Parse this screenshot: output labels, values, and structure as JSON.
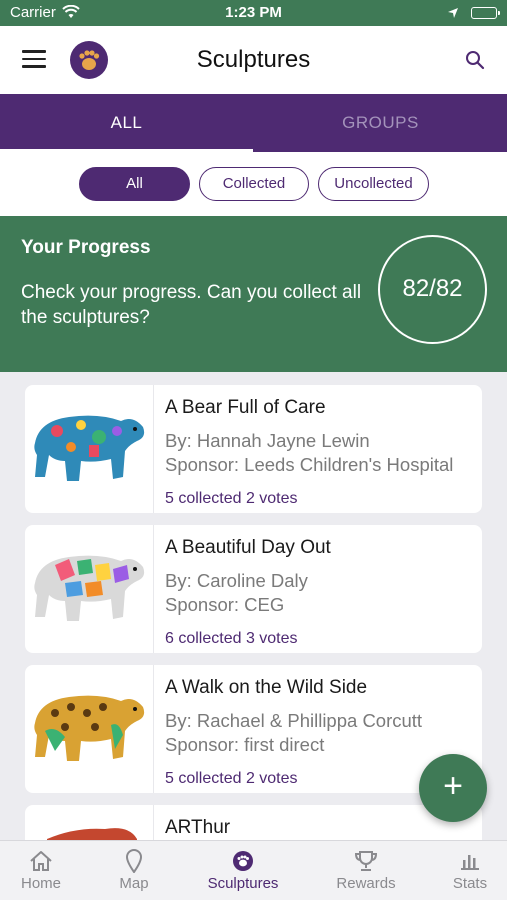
{
  "status_bar": {
    "carrier": "Carrier",
    "time": "1:23 PM"
  },
  "header": {
    "title": "Sculptures"
  },
  "tabs": [
    {
      "label": "ALL",
      "active": true
    },
    {
      "label": "GROUPS",
      "active": false
    }
  ],
  "filters": [
    {
      "label": "All",
      "selected": true
    },
    {
      "label": "Collected",
      "selected": false
    },
    {
      "label": "Uncollected",
      "selected": false
    }
  ],
  "progress": {
    "title": "Your Progress",
    "text": "Check your progress. Can you collect all the sculptures?",
    "value": "82/82"
  },
  "sculptures": [
    {
      "title": "A Bear Full of Care",
      "artist": "By: Hannah Jayne Lewin",
      "sponsor": "Sponsor: Leeds Children's Hospital",
      "stats": "5 collected 2 votes"
    },
    {
      "title": "A Beautiful Day Out",
      "artist": "By: Caroline Daly",
      "sponsor": "Sponsor: CEG",
      "stats": "6 collected 3 votes"
    },
    {
      "title": "A Walk on the Wild Side",
      "artist": "By: Rachael & Phillippa Corcutt",
      "sponsor": "Sponsor: first direct",
      "stats": "5 collected 2 votes"
    },
    {
      "title": "ARThur",
      "artist": "",
      "sponsor": "",
      "stats": ""
    }
  ],
  "fab": {
    "label": "+"
  },
  "nav": [
    {
      "label": "Home",
      "icon": "home-icon"
    },
    {
      "label": "Map",
      "icon": "map-pin-icon"
    },
    {
      "label": "Sculptures",
      "icon": "bear-logo-icon",
      "active": true
    },
    {
      "label": "Rewards",
      "icon": "trophy-icon"
    },
    {
      "label": "Stats",
      "icon": "bar-chart-icon"
    }
  ],
  "colors": {
    "brand_purple": "#4e2a72",
    "brand_green": "#3f7a56"
  }
}
